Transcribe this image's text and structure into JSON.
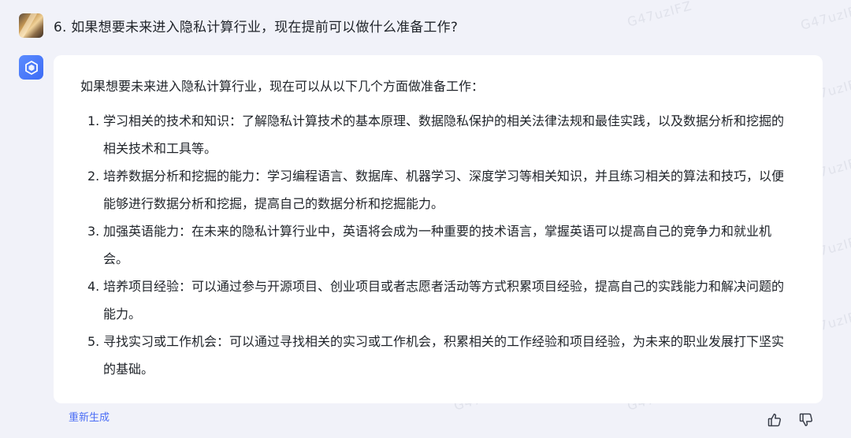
{
  "question": {
    "text": "6. 如果想要未来进入隐私计算行业，现在提前可以做什么准备工作?"
  },
  "answer": {
    "intro": "如果想要未来进入隐私计算行业，现在可以从以下几个方面做准备工作：",
    "points": [
      {
        "num": "1.",
        "text": "学习相关的技术和知识：了解隐私计算技术的基本原理、数据隐私保护的相关法律法规和最佳实践，以及数据分析和挖掘的相关技术和工具等。"
      },
      {
        "num": "2.",
        "text": "培养数据分析和挖掘的能力：学习编程语言、数据库、机器学习、深度学习等相关知识，并且练习相关的算法和技巧，以便能够进行数据分析和挖掘，提高自己的数据分析和挖掘能力。"
      },
      {
        "num": "3.",
        "text": "加强英语能力：在未来的隐私计算行业中，英语将会成为一种重要的技术语言，掌握英语可以提高自己的竞争力和就业机会。"
      },
      {
        "num": "4.",
        "text": "培养项目经验：可以通过参与开源项目、创业项目或者志愿者活动等方式积累项目经验，提高自己的实践能力和解决问题的能力。"
      },
      {
        "num": "5.",
        "text": "寻找实习或工作机会：可以通过寻找相关的实习或工作机会，积累相关的工作经验和项目经验，为未来的职业发展打下坚实的基础。"
      }
    ]
  },
  "actions": {
    "regenerate_label": "重新生成"
  },
  "icons": {
    "user_avatar": "user-avatar-image",
    "bot_avatar": "cube-logo-icon",
    "like": "thumbs-up-icon",
    "dislike": "thumbs-down-icon"
  },
  "colors": {
    "accent": "#4c6ef5",
    "bot_avatar": "#3d6bf5",
    "background": "#f1f2f9",
    "card": "#ffffff"
  },
  "watermark": {
    "text": "G47uzIFZ"
  }
}
